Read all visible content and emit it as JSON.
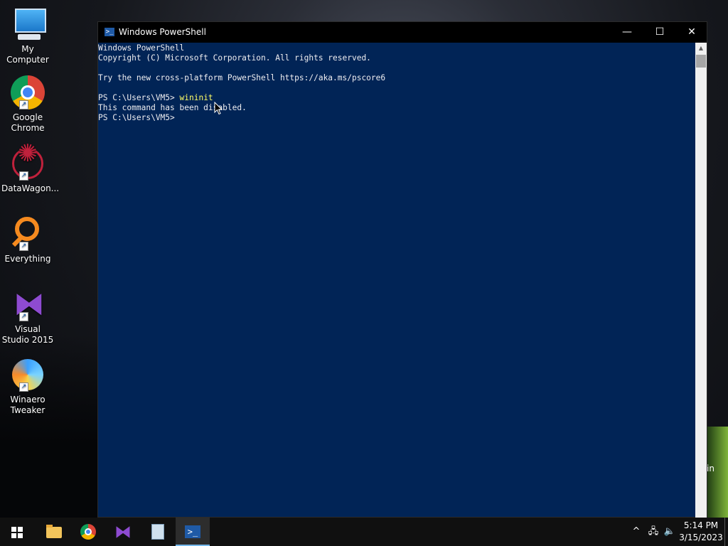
{
  "desktop": {
    "icons": [
      {
        "label": "My Computer",
        "icon": "computer-icon"
      },
      {
        "label": "Google Chrome",
        "icon": "chrome-icon"
      },
      {
        "label": "DataWagon...",
        "icon": "datawagon-icon"
      },
      {
        "label": "Everything",
        "icon": "everything-icon"
      },
      {
        "label": "Visual Studio 2015",
        "icon": "visual-studio-icon"
      },
      {
        "label": "Winaero Tweaker",
        "icon": "winaero-icon"
      }
    ],
    "watermark_fragment": "in"
  },
  "window": {
    "title": "Windows PowerShell",
    "controls": {
      "minimize": "—",
      "maximize": "☐",
      "close": "✕"
    },
    "console": {
      "line1": "Windows PowerShell",
      "line2": "Copyright (C) Microsoft Corporation. All rights reserved.",
      "line3": "Try the new cross-platform PowerShell https://aka.ms/pscore6",
      "prompt1": "PS C:\\Users\\VM5> ",
      "command1": "wininit",
      "output1": "This command has been disabled.",
      "prompt2": "PS C:\\Users\\VM5> "
    },
    "colors": {
      "background": "#012456",
      "text": "#eeedf0",
      "command": "#ffff66"
    }
  },
  "taskbar": {
    "apps": [
      "start-icon",
      "file-explorer-icon",
      "chrome-icon",
      "visual-studio-icon",
      "calculator-icon",
      "powershell-icon"
    ],
    "active_app": "powershell-icon",
    "clock": {
      "time": "5:14 PM",
      "date": "3/15/2023"
    },
    "tray_icons": [
      "chevron-up-icon",
      "network-icon",
      "volume-icon"
    ]
  }
}
